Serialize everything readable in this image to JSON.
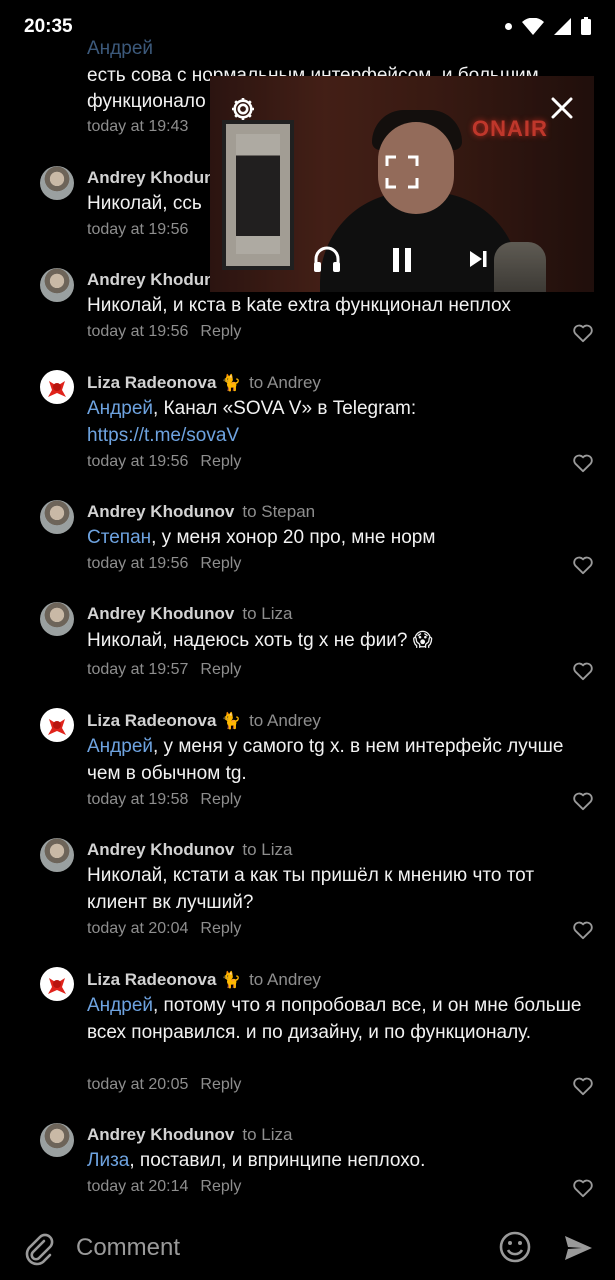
{
  "status_bar": {
    "time": "20:35"
  },
  "top_partial": {
    "line1_mention": "Андрей",
    "line2": "есть сова с нормальным интерфейсом, и большим",
    "line3": "функционало",
    "time": "today at 19:43"
  },
  "comments": [
    {
      "author": "Andrey Khodun",
      "to": "",
      "text": "Николай, ссь",
      "time": "today at 19:56",
      "reply": ""
    },
    {
      "author": "Andrey Khodun",
      "to": "",
      "text": "Николай, и кста в kate extra функционал неплох",
      "time": "today at 19:56",
      "reply": "Reply"
    },
    {
      "author": "Liza Radeonova",
      "emoji": "🐈",
      "to": "to Andrey",
      "mention": "Андрей",
      "text": ", Канал «SOVA V» в Telegram:",
      "link": "https://t.me/sovaV",
      "time": "today at 19:56",
      "reply": "Reply"
    },
    {
      "author": "Andrey Khodunov",
      "to": "to Stepan",
      "mention": "Степан",
      "text": ", у меня хонор 20 про, мне норм",
      "time": "today at 19:56",
      "reply": "Reply"
    },
    {
      "author": "Andrey Khodunov",
      "to": "to Liza",
      "text": "Николай,  надеюсь хоть tg x не фии? 😱",
      "time": "today at 19:57",
      "reply": "Reply"
    },
    {
      "author": "Liza Radeonova",
      "emoji": "🐈",
      "to": "to Andrey",
      "mention": "Андрей",
      "text": ", у меня у самого tg x. в нем интерфейс лучше чем в обычном tg.",
      "time": "today at 19:58",
      "reply": "Reply"
    },
    {
      "author": "Andrey Khodunov",
      "to": "to Liza",
      "text": "Николай, кстати а как ты пришёл к мнению что тот клиент вк лучший?",
      "time": "today at 20:04",
      "reply": "Reply"
    },
    {
      "author": "Liza Radeonova",
      "emoji": "🐈",
      "to": "to Andrey",
      "mention": "Андрей",
      "text": ", потому что я попробовал все, и он мне больше всех понравился. и по дизайну, и по функционалу.",
      "time": "today at 20:05",
      "reply": "Reply"
    },
    {
      "author": "Andrey Khodunov",
      "to": "to Liza",
      "mention": "Лиза",
      "text": ", поставил, и впринципе неплохо.",
      "time": "today at 20:14",
      "reply": "Reply"
    }
  ],
  "pip": {
    "sign": "ONAIR"
  },
  "composer": {
    "placeholder": "Comment"
  },
  "colors": {
    "background": "#000000",
    "mention": "#6ea3e0",
    "muted": "#8e8e8e"
  }
}
